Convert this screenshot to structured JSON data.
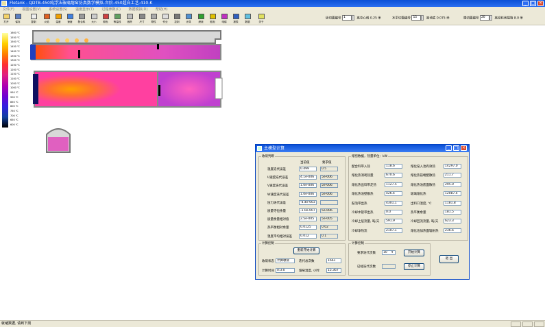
{
  "window": {
    "title": "Fletank - QDTB-450纯浮法玻璃熔窑仿真数学模拟-台阶-450超白工艺-410-K",
    "minimize": "_",
    "maximize": "□",
    "close": "×"
  },
  "menu": [
    "文件(F)",
    "视图设置(V)",
    "系统设置(S)",
    "温度显示(T)",
    "过程参数(C)",
    "数据模拟(D)",
    "帮助(H)"
  ],
  "toolbar": [
    {
      "label": "打开",
      "icon": "open-icon"
    },
    {
      "label": "保存",
      "icon": "save-icon"
    },
    {
      "label": "复制",
      "icon": "copy-icon"
    },
    {
      "label": "火焰",
      "icon": "flame-icon"
    },
    {
      "label": "温度",
      "icon": "temperature-icon"
    },
    {
      "label": "速度",
      "icon": "velocity-icon"
    },
    {
      "label": "配合料",
      "icon": "batch-icon"
    },
    {
      "label": "大小",
      "icon": "size-icon"
    },
    {
      "label": "颜色",
      "icon": "color-icon"
    },
    {
      "label": "等温线",
      "icon": "isotherm-icon"
    },
    {
      "label": "追踪",
      "icon": "trace-icon"
    },
    {
      "label": "尺寸",
      "icon": "dimension-icon"
    },
    {
      "label": "物性",
      "icon": "property-icon"
    },
    {
      "label": "作业",
      "icon": "job-icon"
    },
    {
      "label": "控制",
      "icon": "control-icon"
    },
    {
      "label": "计算",
      "icon": "calculate-icon"
    },
    {
      "label": "燃烧",
      "icon": "combustion-icon"
    },
    {
      "label": "鼓泡",
      "icon": "bubbling-icon"
    },
    {
      "label": "电熔",
      "icon": "electric-icon"
    },
    {
      "label": "报表",
      "icon": "report-icon"
    },
    {
      "label": "数据",
      "icon": "data-icon"
    },
    {
      "label": "关于",
      "icon": "about-icon"
    }
  ],
  "right_tools": {
    "section_label": "纵切面编号",
    "section_value": "1",
    "center_label": "离中心线",
    "center_value": "0.25 米",
    "horizontal_label": "水平切面编号",
    "horizontal_value": "15",
    "bottom_label": "离池底",
    "bottom_value": "0.075 米",
    "cross_label": "横切面编号",
    "cross_value": "20",
    "from_label": "离投料池端墙",
    "from_value": "8.0 米"
  },
  "legend": {
    "ticks": [
      "1600 ℃",
      "1550 ℃",
      "1500 ℃",
      "1450 ℃",
      "1400 ℃",
      "1350 ℃",
      "1300 ℃",
      "1250 ℃",
      "1200 ℃",
      "1150 ℃",
      "1100 ℃",
      "1050 ℃",
      "1000 ℃",
      "950 ℃",
      "900 ℃",
      "850 ℃",
      "800 ℃",
      "750 ℃",
      "700 ℃",
      "650 ℃",
      "600 ℃"
    ]
  },
  "dialog": {
    "title": "主模型计算",
    "convergence": {
      "group": "收敛判断",
      "col_current": "当前值",
      "col_target": "要求值",
      "rows": [
        {
          "label": "温度迭代误差",
          "current": "0.499",
          "target": "0.5"
        },
        {
          "label": "U速度迭代误差",
          "current": "4.1e-006",
          "target": "5e-006"
        },
        {
          "label": "V速度迭代误差",
          "current": "1.0e-006",
          "target": "5e-006"
        },
        {
          "label": "W速度迭代误差",
          "current": "1.0e-006",
          "target": "5e-006"
        },
        {
          "label": "压力迭代误差",
          "current": "-4.4e-003",
          "target": ""
        },
        {
          "label": "质量守恒余量",
          "current": "-1.0e-007",
          "target": "5e-006"
        },
        {
          "label": "质量余量相对值",
          "current": "2.5e-005",
          "target": "5e-005"
        },
        {
          "label": "热平衡相对余量",
          "current": "0.0125",
          "target": "0.02"
        },
        {
          "label": "温度平均相对误差",
          "current": "0.012",
          "target": "0.1"
        }
      ]
    },
    "heat": {
      "group": "熔窑数据，热量单位：kW",
      "left": [
        {
          "label": "配合料带入热",
          "value": "118.6"
        },
        {
          "label": "熔化热消耗热量",
          "value": "670.6"
        },
        {
          "label": "熔化热出料带走热",
          "value": "1127.5"
        },
        {
          "label": "熔化热池壁散热",
          "value": "426.4"
        },
        {
          "label": "鼓泡带出热",
          "value": "4301.1"
        },
        {
          "label": "冷却水管带出热",
          "value": "0.0"
        },
        {
          "label": "冷却上层流量, 吨/天",
          "value": "591.9"
        },
        {
          "label": "冷却净热流",
          "value": "2107.1"
        }
      ],
      "right": [
        {
          "label": "熔化窑入池有效热",
          "value": "14297.0"
        },
        {
          "label": "熔化热前端壁散热",
          "value": "211.7"
        },
        {
          "label": "熔化热池底面散热",
          "value": "295.0"
        },
        {
          "label": "玻璃熔化热",
          "value": "12087.4"
        },
        {
          "label": "出料口温度, ℃",
          "value": "1181.8"
        },
        {
          "label": "热平衡余量",
          "value": "181.5"
        },
        {
          "label": "冷却回流流量, 吨/天",
          "value": "623.3"
        },
        {
          "label": "熔化池加热面辐射热",
          "value": "236.6"
        }
      ]
    },
    "calc": {
      "group": "计算控制",
      "restart": "重新开始计算",
      "status_label": "收敛状态",
      "status_value": "计算收敛",
      "iter_label": "迭代总次数",
      "iter_value": "1661",
      "time_label": "计算时间",
      "time_value": "0:3:0",
      "equiv_label": "熔窑温度, 小时",
      "equiv_value": "15.367"
    },
    "control": {
      "group": "计算控制",
      "req_label": "要求迭代次数",
      "req_value": "10",
      "done_label": "已经迭代次数",
      "done_value": "",
      "start": "开始计算",
      "stop": "停止计算",
      "exit": "退 出"
    }
  },
  "status": {
    "text": "就绪数据, 请到下测"
  }
}
